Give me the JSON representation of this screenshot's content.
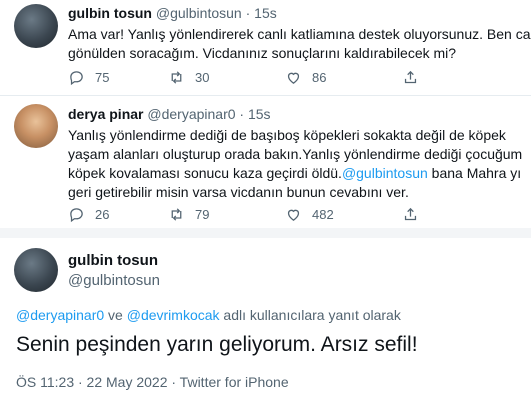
{
  "tweets": [
    {
      "name": "gulbin tosun",
      "handle": "@gulbintosun",
      "dot": "·",
      "time": "15s",
      "lines": [
        "Ama var! Yanlış yönlendirerek canlı katliamına destek oluyorsunuz. Ben canı",
        "gönülden soracağım. Vicdanınız sonuçlarını kaldırabilecek mi?"
      ],
      "replies": "75",
      "retweets": "30",
      "likes": "86"
    },
    {
      "name": "derya pinar",
      "handle": "@deryapinar0",
      "dot": "·",
      "time": "15s",
      "lines": [
        "Yanlış yönlendirme dediği de başıboş köpekleri sokakta değil de köpek",
        "yaşam alanları oluşturup orada bakın.Yanlış yönlendirme dediği çocuğum",
        "köpek kovalaması sonucu kaza geçirdi öldü.",
        "geri getirebilir misin varsa vicdanın bunun cevabını ver."
      ],
      "line3_mention": "@gulbintosun",
      "line3_rest": " bana Mahra yı",
      "replies": "26",
      "retweets": "79",
      "likes": "482"
    }
  ],
  "main": {
    "name": "gulbin tosun",
    "handle": "@gulbintosun",
    "reply_mention1": "@deryapinar0",
    "reply_connector": " ve ",
    "reply_mention2": "@devrimkocak",
    "reply_suffix": " adlı kullanıcılara yanıt olarak",
    "text": "Senin peşinden yarın geliyorum. Arsız sefil!",
    "meta": "ÖS 11:23 · 22 May 2022 · Twitter for iPhone"
  },
  "colors": {
    "accent": "#1d9bf0",
    "muted": "#536471",
    "text": "#0f1419"
  },
  "icons": [
    "reply-icon",
    "retweet-icon",
    "like-icon",
    "share-icon"
  ]
}
